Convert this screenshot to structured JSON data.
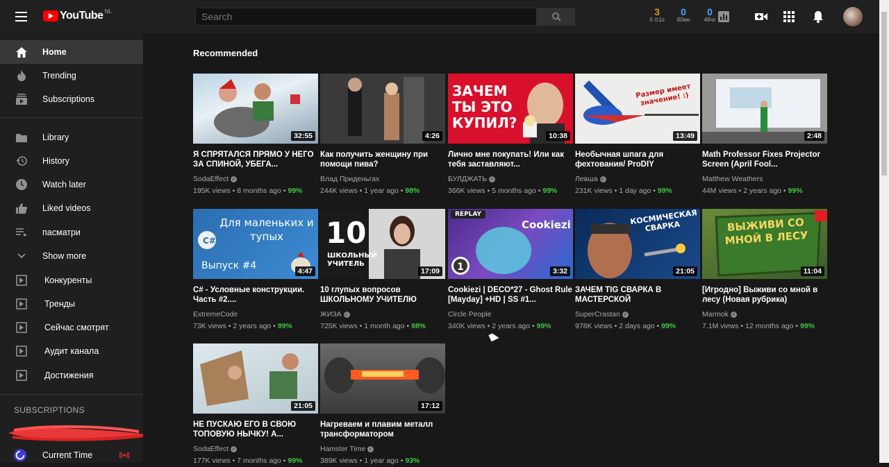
{
  "header": {
    "logo_text": "YouTube",
    "region": "NL",
    "search_placeholder": "Search",
    "counters": [
      {
        "value": "3",
        "label": "5 ⊙1г",
        "color": "#d4a017"
      },
      {
        "value": "0",
        "label": "60мн",
        "color": "#3ea6ff"
      },
      {
        "value": "0",
        "label": "48чс",
        "color": "#3ea6ff"
      }
    ]
  },
  "sidebar": {
    "items": [
      {
        "label": "Home",
        "icon": "home-icon"
      },
      {
        "label": "Trending",
        "icon": "flame-icon"
      },
      {
        "label": "Subscriptions",
        "icon": "subscriptions-icon"
      },
      {
        "label": "Library",
        "icon": "folder-icon"
      },
      {
        "label": "History",
        "icon": "history-icon"
      },
      {
        "label": "Watch later",
        "icon": "clock-icon"
      },
      {
        "label": "Liked videos",
        "icon": "thumbs-up-icon"
      },
      {
        "label": "пасматри",
        "icon": "playlist-icon"
      },
      {
        "label": "Show more",
        "icon": "chevron-down-icon"
      },
      {
        "label": "Конкуренты",
        "icon": "extension-icon"
      },
      {
        "label": "Тренды",
        "icon": "extension-icon"
      },
      {
        "label": "Сейчас смотрят",
        "icon": "extension-icon"
      },
      {
        "label": "Аудит канала",
        "icon": "extension-icon"
      },
      {
        "label": "Достижения",
        "icon": "extension-icon"
      }
    ],
    "subscriptions_heading": "SUBSCRIPTIONS",
    "subscriptions": [
      {
        "label": "Current Time",
        "live": true
      }
    ]
  },
  "main": {
    "section_title": "Recommended",
    "videos": [
      {
        "title": "Я СПРЯТАЛСЯ ПРЯМО У НЕГО ЗА СПИНОЙ, УБЕГА...",
        "channel": "SodaEffect",
        "verified": true,
        "views": "195K views",
        "age": "8 months ago",
        "rating": "99%",
        "duration": "32:55"
      },
      {
        "title": "Как получить женщину при помощи пива?",
        "channel": "Влад Приденьгах",
        "verified": false,
        "views": "244K views",
        "age": "1 year ago",
        "rating": "98%",
        "duration": "4:26"
      },
      {
        "title": "Лично мне покупать! Или как тебя заставляют...",
        "channel": "БУЛДЖАТЬ",
        "verified": true,
        "views": "366K views",
        "age": "5 months ago",
        "rating": "99%",
        "duration": "10:38",
        "thumb_text": "ЗАЧЕМ ТЫ ЭТО КУПИЛ?"
      },
      {
        "title": "Необычная шпага для фехтования/ ProDIY",
        "channel": "Левша",
        "verified": true,
        "views": "231K views",
        "age": "1 day ago",
        "rating": "99%",
        "duration": "13:49",
        "thumb_text": "Размер имеет значение! :)"
      },
      {
        "title": "Math Professor Fixes Projector Screen (April Fool...",
        "channel": "Matthew Weathers",
        "verified": false,
        "views": "44M views",
        "age": "2 years ago",
        "rating": "99%",
        "duration": "2:48"
      },
      {
        "title": "C# - Условные конструкции. Часть #2....",
        "channel": "ExtremeCode",
        "verified": false,
        "views": "73K views",
        "age": "2 years ago",
        "rating": "99%",
        "duration": "4:47",
        "thumb_text": "Для маленьких и тупых",
        "thumb_sub": "Выпуск #4"
      },
      {
        "title": "10 глупых вопросов ШКОЛЬНОМУ УЧИТЕЛЮ",
        "channel": "ЖИЗА",
        "verified": true,
        "views": "725K views",
        "age": "1 month ago",
        "rating": "98%",
        "duration": "17:09",
        "thumb_text": "10",
        "thumb_sub": "ШКОЛЬНЫЙ УЧИТЕЛЬ"
      },
      {
        "title": "Cookiezi | DECO*27 - Ghost Rule [Mayday] +HD | SS #1...",
        "channel": "Circle People",
        "verified": false,
        "views": "340K views",
        "age": "2 years ago",
        "rating": "99%",
        "duration": "3:32",
        "thumb_text": "Cookiezi",
        "thumb_sub": "REPLAY"
      },
      {
        "title": "ЗАЧЕМ TIG СВАРКА В МАСТЕРСКОЙ",
        "channel": "SuperCrastan",
        "verified": true,
        "views": "978K views",
        "age": "2 days ago",
        "rating": "99%",
        "duration": "21:05",
        "thumb_text": "КОСМИЧЕСКАЯ СВАРКА"
      },
      {
        "title": "[Игродно] Выживи со мной в лесу (Новая рубрика)",
        "channel": "Marmok",
        "verified": true,
        "views": "7.1M views",
        "age": "12 months ago",
        "rating": "99%",
        "duration": "11:04",
        "thumb_text": "ВЫЖИВИ СО МНОЙ В ЛЕСУ"
      },
      {
        "title": "НЕ ПУСКАЮ ЕГО В СВОЮ ТОПОВУЮ НЫЧКУ! А...",
        "channel": "SodaEffect",
        "verified": true,
        "views": "177K views",
        "age": "7 months ago",
        "rating": "99%",
        "duration": "21:05"
      },
      {
        "title": "Нагреваем и плавим металл трансформатором",
        "channel": "Hamster Time",
        "verified": true,
        "views": "389K views",
        "age": "1 year ago",
        "rating": "93%",
        "duration": "17:12"
      }
    ]
  },
  "colors": {
    "background": "#181818",
    "sidebar": "#1f1f1f",
    "topbar": "#202020",
    "rating": "#3ec93e",
    "brand": "#ff0000"
  }
}
